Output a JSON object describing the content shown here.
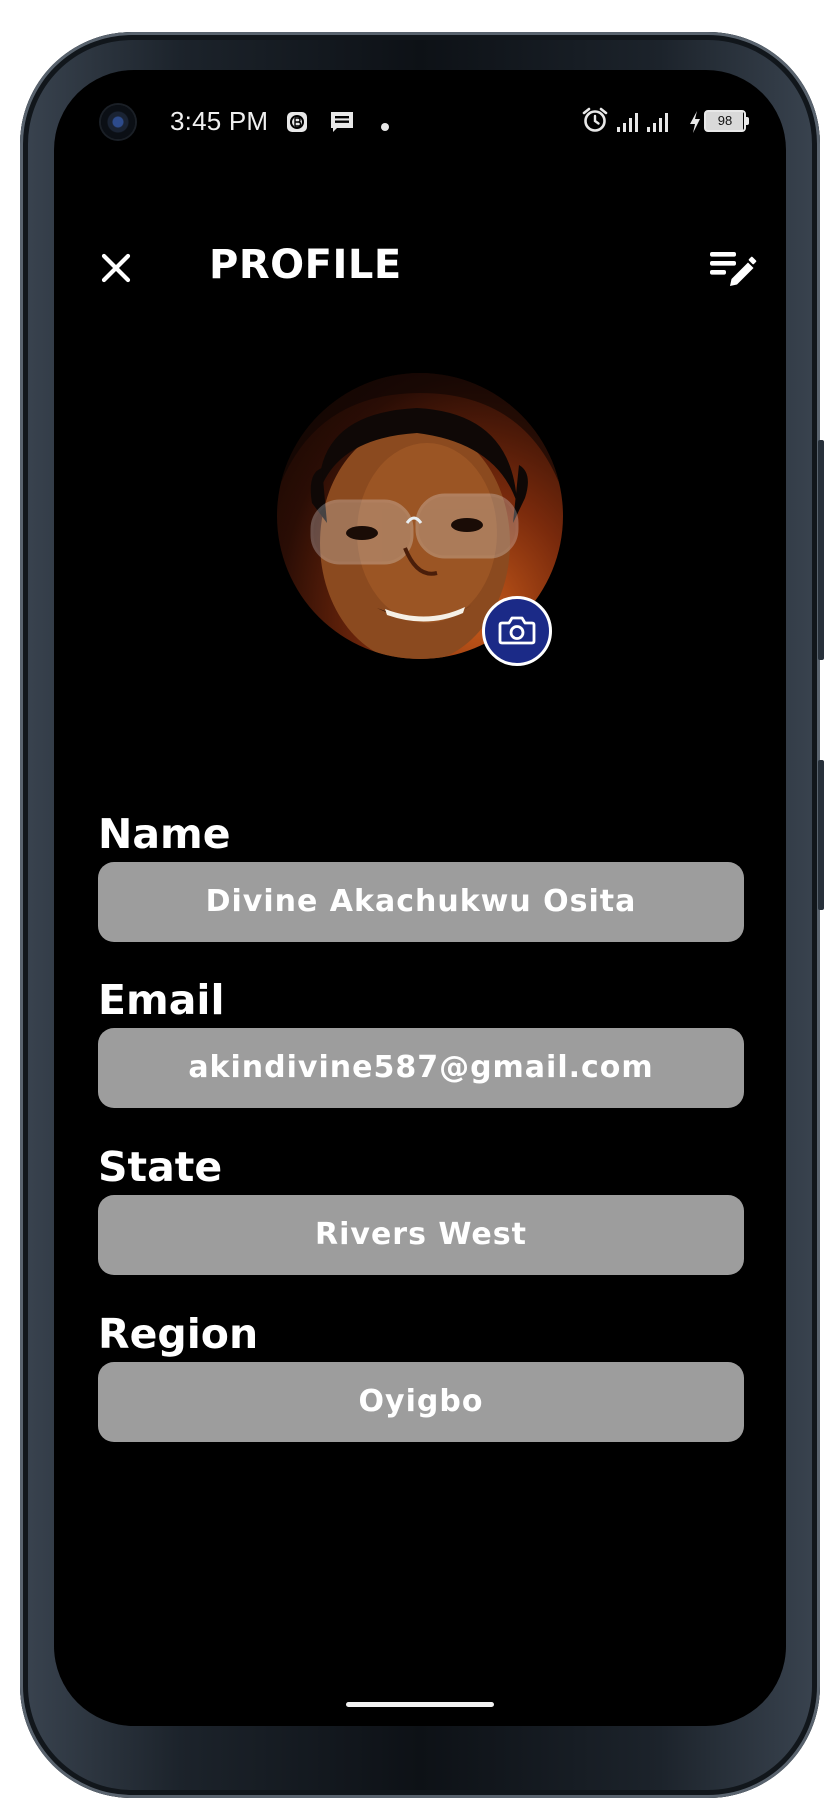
{
  "status_bar": {
    "time": "3:45 PM",
    "battery": "98"
  },
  "app_bar": {
    "title": "PROFILE"
  },
  "fields": [
    {
      "label": "Name",
      "value": "Divine Akachukwu Osita"
    },
    {
      "label": "Email",
      "value": "akindivine587@gmail.com"
    },
    {
      "label": "State",
      "value": "Rivers West"
    },
    {
      "label": "Region",
      "value": "Oyigbo"
    }
  ],
  "colors": {
    "background": "#000000",
    "field_background": "#9d9d9d",
    "camera_button": "#1b2a87",
    "text": "#ffffff"
  },
  "icons": {
    "close": "close-icon",
    "edit": "edit-list-icon",
    "camera": "camera-icon"
  }
}
